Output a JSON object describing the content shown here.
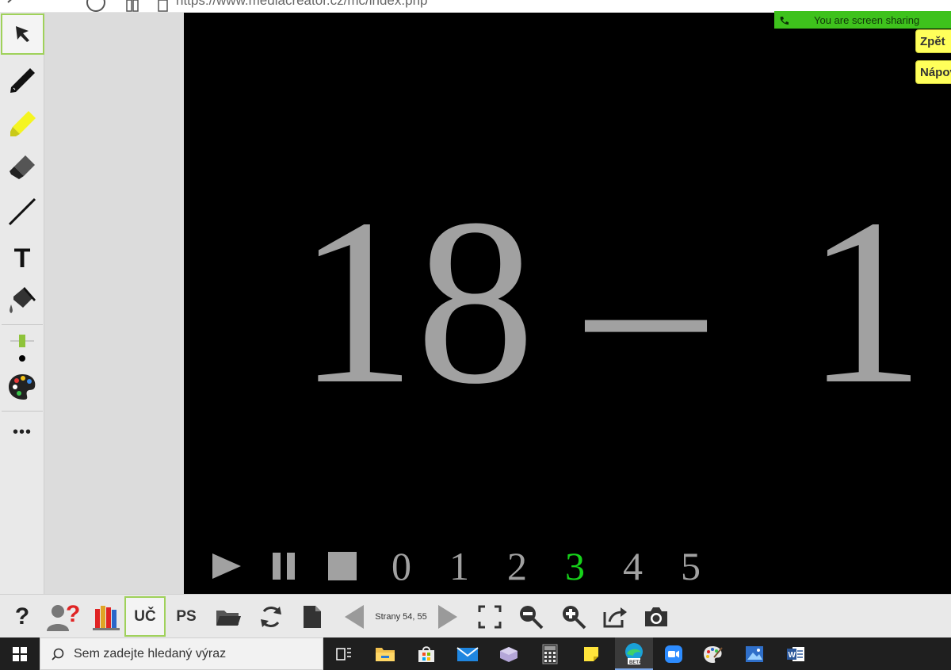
{
  "browser": {
    "url": "https://www.mediacreator.cz/mc/index.php"
  },
  "share_banner": {
    "text": "You are screen sharing",
    "color": "#3ec21c"
  },
  "side_buttons": [
    {
      "label": "Zpět"
    },
    {
      "label": "Nápověda"
    }
  ],
  "stage": {
    "expression": {
      "left": "18",
      "operator": "–",
      "right": "1"
    },
    "steps": [
      "0",
      "1",
      "2",
      "3",
      "4",
      "5"
    ],
    "active_step": "3",
    "active_color": "#16d21a"
  },
  "left_tools": [
    {
      "icon": "cursor-arrow-icon",
      "selected": true
    },
    {
      "icon": "pen-icon"
    },
    {
      "icon": "highlighter-icon"
    },
    {
      "icon": "eraser-icon"
    },
    {
      "icon": "line-icon"
    },
    {
      "icon": "text-tool-icon",
      "label": "T"
    },
    {
      "icon": "fill-bucket-icon"
    },
    {
      "icon": "line-width-icon"
    },
    {
      "icon": "color-palette-icon"
    },
    {
      "icon": "more-icon",
      "label": "•••"
    }
  ],
  "bottom_toolbar": {
    "help_label": "?",
    "uc_label": "UČ",
    "ps_label": "PS",
    "pages_label": "Strany 54, 55"
  },
  "taskbar": {
    "search_placeholder": "Sem zadejte hledaný výraz"
  }
}
